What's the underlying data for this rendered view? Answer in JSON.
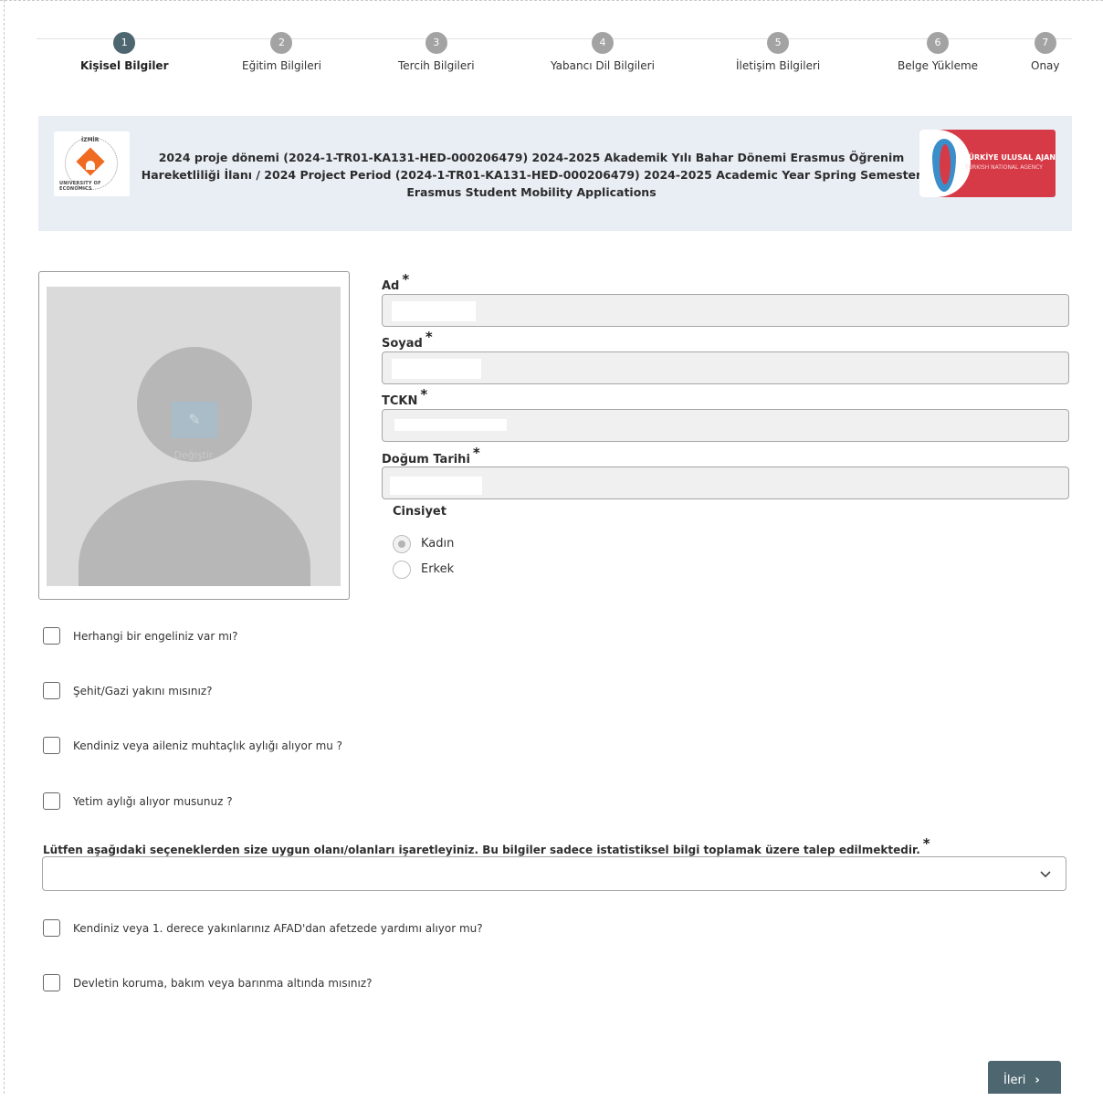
{
  "stepper": [
    {
      "num": "1",
      "label": "Kişisel Bilgiler"
    },
    {
      "num": "2",
      "label": "Eğitim Bilgileri"
    },
    {
      "num": "3",
      "label": "Tercih Bilgileri"
    },
    {
      "num": "4",
      "label": "Yabancı Dil Bilgileri"
    },
    {
      "num": "5",
      "label": "İletişim Bilgileri"
    },
    {
      "num": "6",
      "label": "Belge Yükleme"
    },
    {
      "num": "7",
      "label": "Onay"
    }
  ],
  "banner": {
    "title": "2024 proje dönemi (2024-1-TR01-KA131-HED-000206479) 2024-2025 Akademik Yılı Bahar Dönemi Erasmus Öğrenim Hareketliliği İlanı / 2024 Project Period (2024-1-TR01-KA131-HED-000206479) 2024-2025 Academic Year Spring Semester Erasmus Student Mobility Applications",
    "ieu_top": "İZMİR",
    "ieu_arc": "UNIVERSITY OF ECONOMICS",
    "tua_line1": "TÜRKİYE ULUSAL AJANSI",
    "tua_line2": "TURKISH NATIONAL AGENCY"
  },
  "photo": {
    "hint": "Değiştir",
    "edit_icon": "pencil-icon"
  },
  "fields": {
    "first_name": {
      "label": "Ad",
      "value": ""
    },
    "last_name": {
      "label": "Soyad",
      "value": ""
    },
    "tckn": {
      "label": "TCKN",
      "value": ""
    },
    "birth_date": {
      "label": "Doğum Tarihi",
      "value": ""
    },
    "required_mark": "*"
  },
  "gender": {
    "label": "Cinsiyet",
    "options": [
      {
        "label": "Kadın",
        "checked": true
      },
      {
        "label": "Erkek",
        "checked": false
      }
    ]
  },
  "checkboxes": [
    {
      "label": "Herhangi bir engeliniz var mı?",
      "checked": false
    },
    {
      "label": "Şehit/Gazi yakını mısınız?",
      "checked": false
    },
    {
      "label": "Kendiniz veya aileniz muhtaçlık aylığı alıyor mu ?",
      "checked": false
    },
    {
      "label": "Yetim aylığı alıyor musunuz ?",
      "checked": false
    }
  ],
  "statistics": {
    "label": "Lütfen aşağıdaki seçeneklerden size uygun olanı/olanları işaretleyiniz. Bu bilgiler sadece istatistiksel bilgi toplamak üzere talep edilmektedir.",
    "selected": ""
  },
  "checkboxes_2": [
    {
      "label": "Kendiniz veya 1. derece yakınlarınız AFAD'dan afetzede yardımı alıyor mu?",
      "checked": false
    },
    {
      "label": "Devletin koruma, bakım veya barınma altında mısınız?",
      "checked": false
    }
  ],
  "next_button": {
    "label": "İleri",
    "arrow": "›"
  },
  "colors": {
    "accent": "#4d6670",
    "banner_bg": "#e9eef5",
    "tua_red": "#d73a47",
    "ieu_orange": "#ef6b22"
  }
}
